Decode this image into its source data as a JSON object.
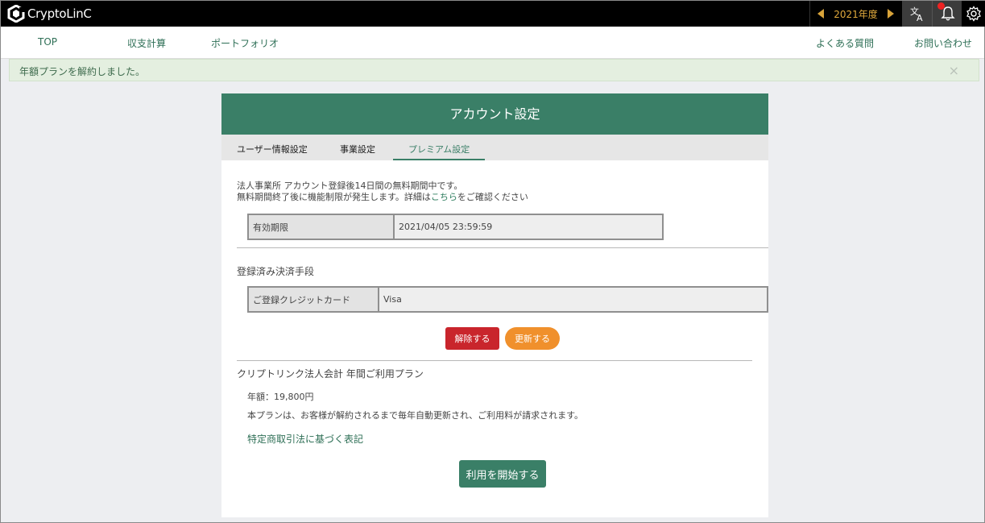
{
  "topbar": {
    "logo_text": "CryptoLinC",
    "year": "2021年度"
  },
  "nav": {
    "top": "TOP",
    "income": "収支計算",
    "portfolio": "ポートフォリオ",
    "faq": "よくある質問",
    "contact": "お問い合わせ"
  },
  "alert": {
    "message": "年額プランを解約しました。",
    "close": "×"
  },
  "card": {
    "title": "アカウント設定",
    "tabs": [
      "ユーザー情報設定",
      "事業設定",
      "プレミアム設定"
    ],
    "info_line1": "法人事業所 アカウント登録後14日間の無料期間中です。",
    "info_line2_pre": "無料期間終了後に機能制限が発生します。詳細は",
    "info_line2_link": "こちら",
    "info_line2_post": "をご確認ください",
    "expiry_label": "有効期限",
    "expiry_value": "2021/04/05 23:59:59",
    "payment_title": "登録済み決済手段",
    "card_label": "ご登録クレジットカード",
    "card_value": "Visa",
    "cancel_button": "解除する",
    "renew_button": "更新する",
    "plan_title": "クリプトリンク法人会計 年間ご利用プラン",
    "plan_price": "年額：19,800円",
    "plan_desc": "本プランは、お客様が解約されるまで毎年自動更新され、ご利用料が請求されます。",
    "plan_link": "特定商取引法に基づく表記",
    "start_button": "利用を開始する"
  }
}
